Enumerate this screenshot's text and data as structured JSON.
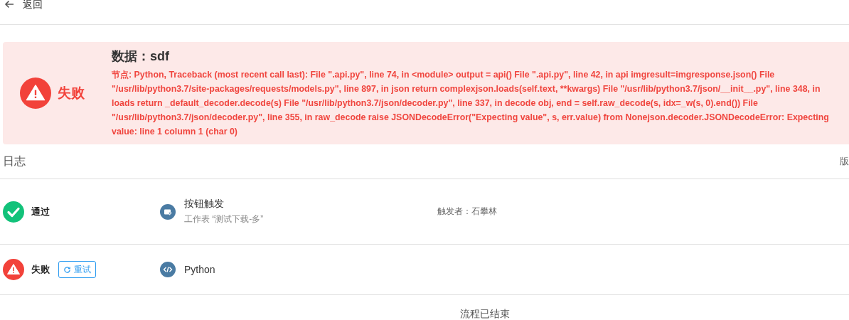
{
  "header": {
    "back_label": "返回"
  },
  "result": {
    "kind": "failed",
    "status_label": "失败",
    "title": "数据：sdf",
    "message": "节点: Python, Traceback (most recent call last): File \".api.py\", line 74, in <module> output = api() File \".api.py\", line 42, in api imgresult=imgresponse.json() File \"/usr/lib/python3.7/site-packages/requests/models.py\", line 897, in json return complexjson.loads(self.text, **kwargs) File \"/usr/lib/python3.7/json/__init__.py\", line 348, in loads return _default_decoder.decode(s) File \"/usr/lib/python3.7/json/decoder.py\", line 337, in decode obj, end = self.raw_decode(s, idx=_w(s, 0).end()) File \"/usr/lib/python3.7/json/decoder.py\", line 355, in raw_decode raise JSONDecodeError(\"Expecting value\", s, err.value) from Nonejson.decoder.JSONDecodeError: Expecting value: line 1 column 1 (char 0)"
  },
  "log": {
    "title": "日志",
    "side_label": "版",
    "rows": [
      {
        "kind": "passed",
        "status_label": "通过",
        "node": {
          "kind": "button",
          "title": "按钮触发",
          "subtitle": "工作表 “测试下载-多”"
        },
        "trigger": "触发者：石攀林"
      },
      {
        "kind": "failed",
        "status_label": "失败",
        "retry_label": "重试",
        "node": {
          "kind": "code",
          "title": "Python"
        }
      }
    ],
    "footer": "流程已结束"
  }
}
